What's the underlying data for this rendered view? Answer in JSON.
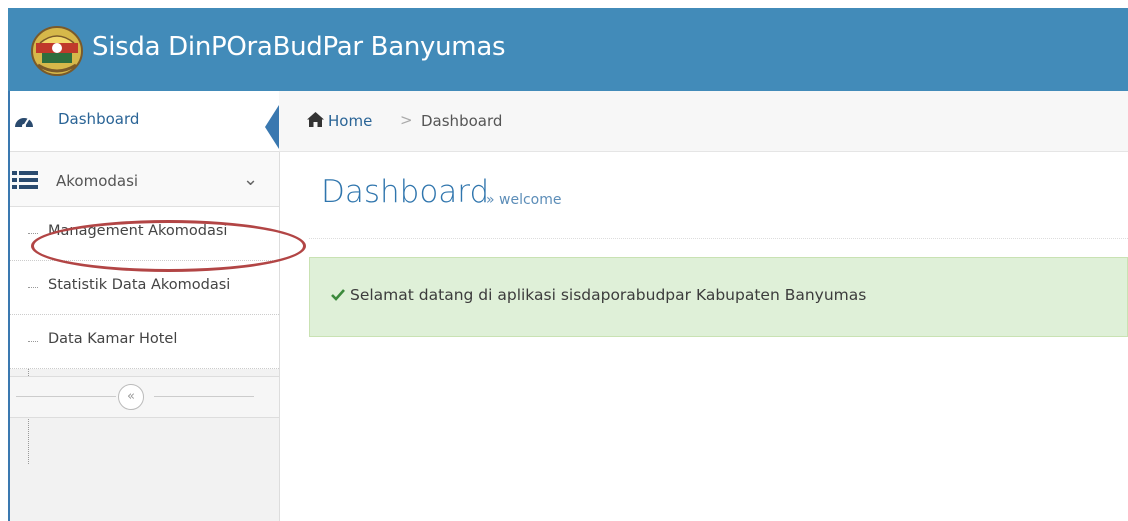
{
  "header": {
    "title": "Sisda DinPOraBudPar Banyumas",
    "logo_icon": "crest-icon",
    "bg_color": "#428bb9"
  },
  "sidebar": {
    "items": [
      {
        "label": "Dashboard",
        "icon": "dashboard-icon",
        "active": true
      },
      {
        "label": "Akomodasi",
        "icon": "list-icon",
        "expanded": true,
        "children": [
          {
            "label": "Management Akomodasi",
            "highlighted": true
          },
          {
            "label": "Statistik Data Akomodasi"
          },
          {
            "label": "Data Kamar Hotel"
          }
        ]
      }
    ],
    "collapse_glyph": "«"
  },
  "breadcrumb": {
    "home": "Home",
    "separator": ">",
    "current": "Dashboard"
  },
  "page": {
    "title": "Dashboard",
    "subtitle": "» welcome"
  },
  "alert": {
    "message": "Selamat datang di aplikasi sisdaporabudpar Kabupaten Banyumas",
    "icon": "check-icon",
    "bg_color": "#dff0d8"
  }
}
